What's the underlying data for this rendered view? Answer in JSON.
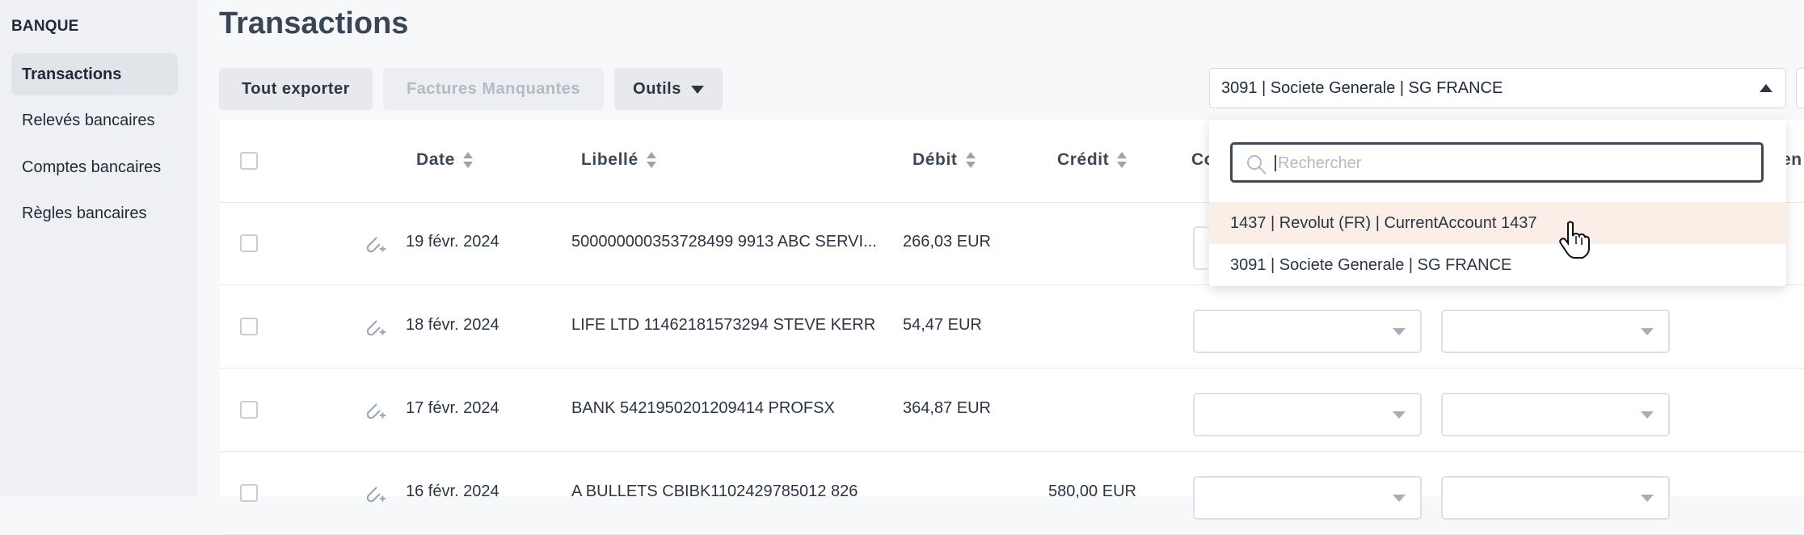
{
  "sidebar": {
    "section": "BANQUE",
    "items": [
      {
        "label": "Transactions",
        "active": true
      },
      {
        "label": "Relevés bancaires"
      },
      {
        "label": "Comptes bancaires"
      },
      {
        "label": "Règles bancaires"
      }
    ]
  },
  "page": {
    "title": "Transactions"
  },
  "toolbar": {
    "export_label": "Tout exporter",
    "missing_label": "Factures Manquantes",
    "tools_label": "Outils"
  },
  "account_select": {
    "value": "3091 | Societe Generale | SG FRANCE",
    "search_placeholder": "Rechercher",
    "options": [
      "1437 | Revolut (FR) | CurrentAccount 1437",
      "3091 | Societe Generale | SG FRANCE"
    ]
  },
  "table": {
    "headers": {
      "date": "Date",
      "libelle": "Libellé",
      "debit": "Débit",
      "credit": "Crédit",
      "compte_partial": "Co",
      "last_partial": "en"
    },
    "rows": [
      {
        "date": "19 févr. 2024",
        "libelle": "500000000353728499 9913 ABC SERVI...",
        "debit": "266,03 EUR",
        "credit": ""
      },
      {
        "date": "18 févr. 2024",
        "libelle": "LIFE LTD 11462181573294 STEVE KERR",
        "debit": "54,47 EUR",
        "credit": ""
      },
      {
        "date": "17 févr. 2024",
        "libelle": "BANK 5421950201209414 PROFSX",
        "debit": "364,87 EUR",
        "credit": ""
      },
      {
        "date": "16 févr. 2024",
        "libelle": "A BULLETS CBIBK1102429785012 826",
        "debit": "",
        "credit": "580,00 EUR"
      }
    ]
  },
  "colors": {
    "hover_option": "#fbeee6",
    "sidebar_bg": "#eef0f3"
  }
}
